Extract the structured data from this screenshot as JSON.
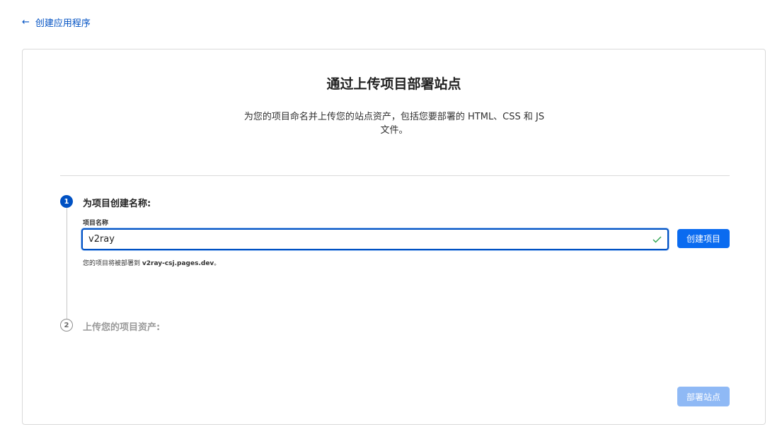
{
  "nav": {
    "back_label": "创建应用程序"
  },
  "card": {
    "title": "通过上传项目部署站点",
    "description": "为您的项目命名并上传您的站点资产，包括您要部署的 HTML、CSS 和 JS 文件。"
  },
  "steps": [
    {
      "number": "1",
      "title": "为项目创建名称:"
    },
    {
      "number": "2",
      "title": "上传您的项目资产:"
    }
  ],
  "project_name": {
    "label": "项目名称",
    "value": "v2ray",
    "hint_prefix": "您的项目将被部署到 ",
    "hint_domain": "v2ray-csj.pages.dev",
    "hint_suffix": "。"
  },
  "buttons": {
    "create_project": "创建项目",
    "deploy_site": "部署站点"
  },
  "colors": {
    "accent": "#0051c3",
    "button": "#0a6bf0",
    "disabled_button": "#8fb9f5"
  }
}
